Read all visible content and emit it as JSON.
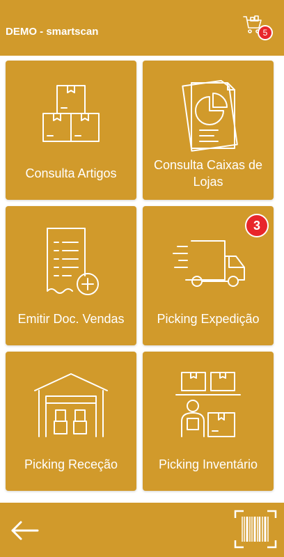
{
  "header": {
    "title": "DEMO - smartscan",
    "cart_icon": "shopping-cart-icon",
    "cart_count": "5"
  },
  "tiles": [
    {
      "label": "Consulta Artigos",
      "icon": "boxes-icon"
    },
    {
      "label": "Consulta Caixas de Lojas",
      "icon": "report-chart-icon"
    },
    {
      "label": "Emitir Doc. Vendas",
      "icon": "receipt-add-icon"
    },
    {
      "label": "Picking Expedição",
      "icon": "delivery-truck-icon",
      "badge": "3"
    },
    {
      "label": "Picking Receção",
      "icon": "warehouse-icon"
    },
    {
      "label": "Picking Inventário",
      "icon": "inventory-worker-icon"
    }
  ],
  "footer": {
    "back_icon": "back-arrow-icon",
    "scan_icon": "barcode-scan-icon"
  },
  "colors": {
    "accent": "#d19a2b",
    "badge": "#e8262b",
    "text": "#ffffff"
  }
}
